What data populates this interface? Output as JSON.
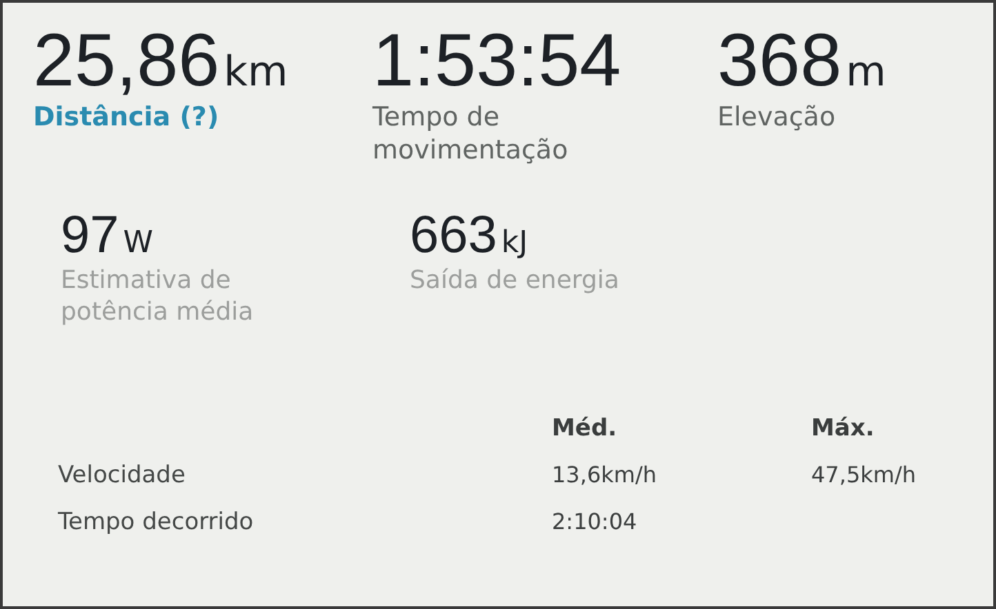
{
  "primary_stats": [
    {
      "value": "25,86",
      "unit": "km",
      "label": "Distância (?)",
      "kind": "link"
    },
    {
      "value": "1:53:54",
      "label": "Tempo de movimentação",
      "kind": "label"
    },
    {
      "value": "368",
      "unit": "m",
      "label": "Elevação",
      "kind": "label"
    }
  ],
  "secondary_stats": [
    {
      "value": "97",
      "unit": "W",
      "label": "Estimativa de potência média"
    },
    {
      "value": "663",
      "unit": "kJ",
      "label": "Saída de energia"
    }
  ],
  "table": {
    "columns": [
      "Méd.",
      "Máx."
    ],
    "rows": [
      {
        "name": "Velocidade",
        "cells": [
          "13,6km/h",
          "47,5km/h"
        ]
      },
      {
        "name": "Tempo decorrido",
        "cells": [
          "2:10:04"
        ]
      }
    ]
  }
}
